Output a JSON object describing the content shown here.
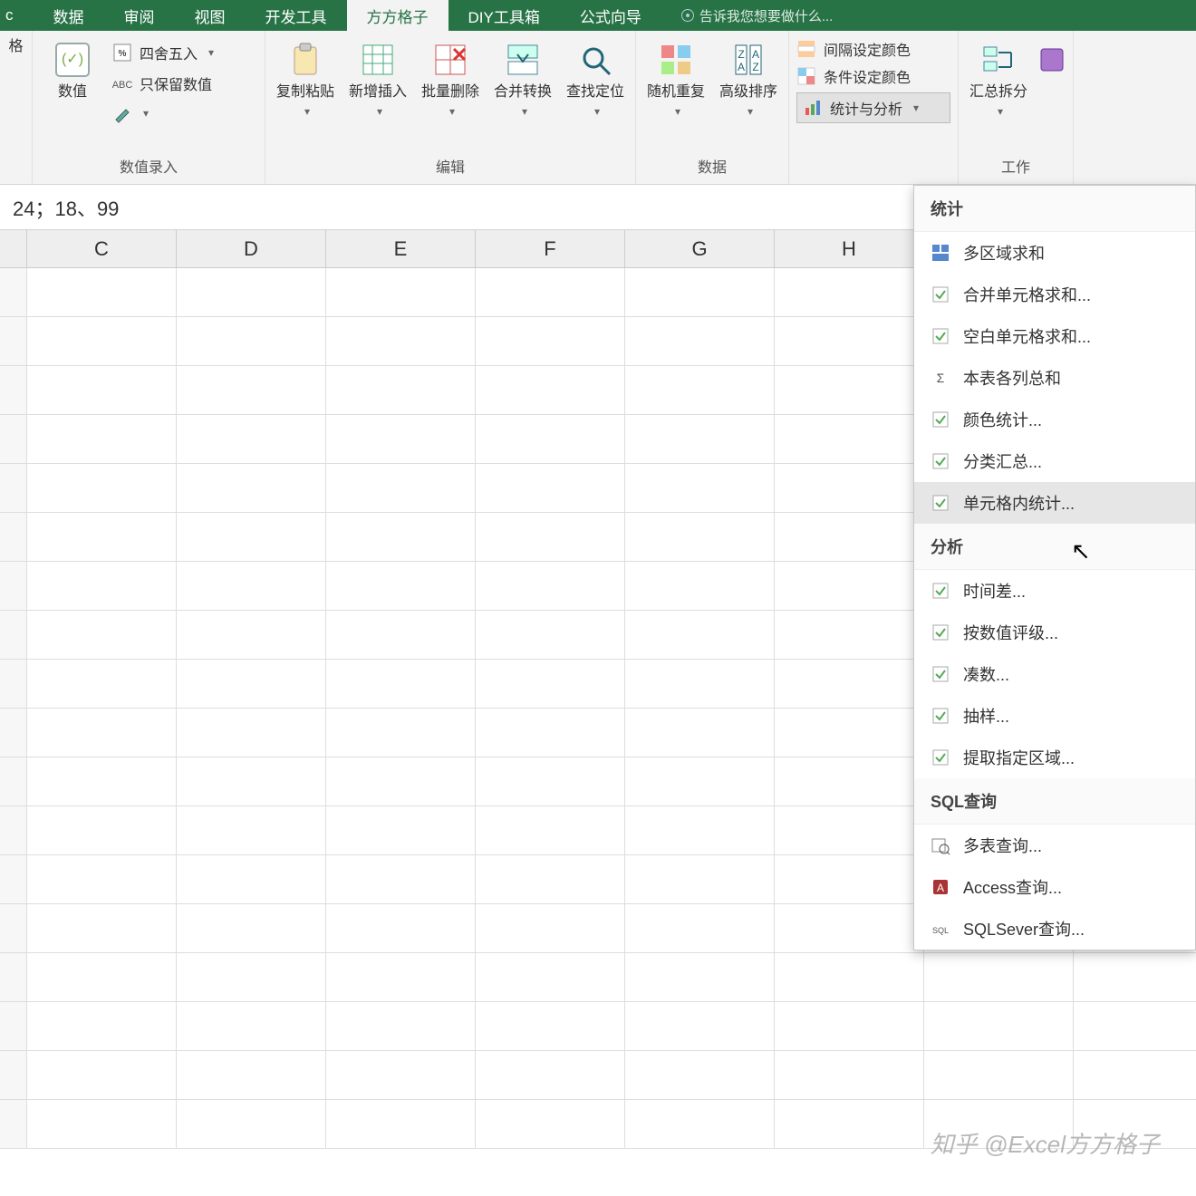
{
  "tabs": [
    "数据",
    "审阅",
    "视图",
    "开发工具",
    "方方格子",
    "DIY工具箱",
    "公式向导"
  ],
  "active_tab": "方方格子",
  "tell_me": "告诉我您想要做什么...",
  "ribbon": {
    "group0_btn": "格",
    "group1": {
      "big": "数值",
      "items": [
        "四舍五入",
        "只保留数值",
        ""
      ],
      "label": "数值录入",
      "pen_icon": "pen"
    },
    "group2": {
      "btns": [
        "复制粘贴",
        "新增插入",
        "批量删除",
        "合并转换",
        "查找定位"
      ],
      "label": "编辑"
    },
    "group3": {
      "btns": [
        "随机重复",
        "高级排序"
      ]
    },
    "group4": {
      "items": [
        "间隔设定颜色",
        "条件设定颜色",
        "统计与分析"
      ],
      "label": "数据"
    },
    "group5": {
      "btn": "汇总拆分",
      "label": "工作"
    }
  },
  "formula_bar": "24；18、99",
  "columns": [
    "C",
    "D",
    "E",
    "F",
    "G",
    "H"
  ],
  "row_count": 18,
  "menu": {
    "sections": [
      {
        "title": "统计",
        "items": [
          "多区域求和",
          "合并单元格求和...",
          "空白单元格求和...",
          "本表各列总和",
          "颜色统计...",
          "分类汇总...",
          "单元格内统计..."
        ]
      },
      {
        "title": "分析",
        "items": [
          "时间差...",
          "按数值评级...",
          "凑数...",
          "抽样...",
          "提取指定区域..."
        ]
      },
      {
        "title": "SQL查询",
        "items": [
          "多表查询...",
          "Access查询...",
          "SQLSever查询..."
        ]
      }
    ],
    "hover_item": "单元格内统计..."
  },
  "watermark": "知乎 @Excel方方格子"
}
